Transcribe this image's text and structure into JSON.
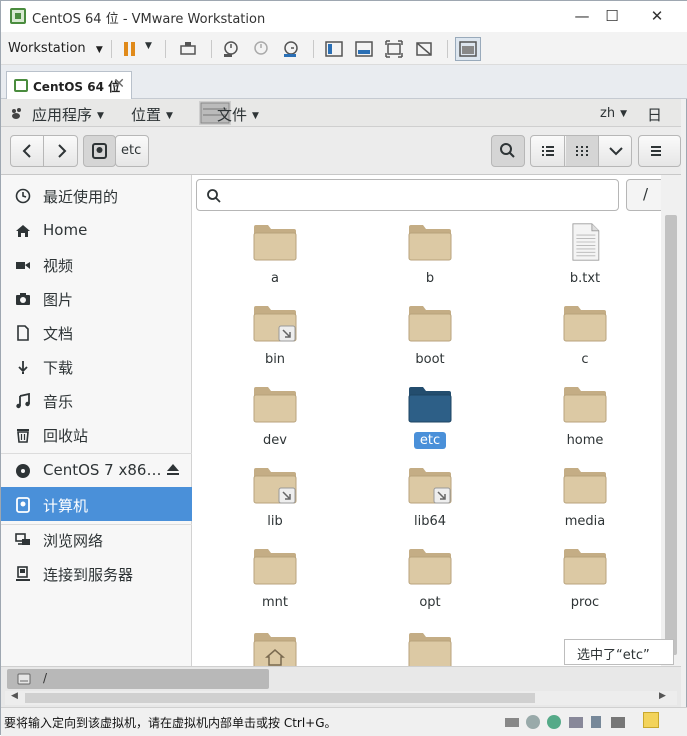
{
  "window": {
    "title": "CentOS 64 位 - VMware Workstation"
  },
  "vmtoolbar": {
    "workstation_label": "Workstation"
  },
  "tab": {
    "label": "CentOS 64 位"
  },
  "gnome": {
    "menu_apps": "应用程序",
    "menu_places": "位置",
    "menu_files": "文件",
    "lang": "zh",
    "date_partial": "日"
  },
  "header": {
    "path_label": "etc"
  },
  "sidebar": {
    "items": [
      {
        "label": "最近使用的",
        "icon": "recent-icon"
      },
      {
        "label": "Home",
        "icon": "home-icon"
      },
      {
        "label": "视频",
        "icon": "video-icon"
      },
      {
        "label": "图片",
        "icon": "camera-icon"
      },
      {
        "label": "文档",
        "icon": "document-icon"
      },
      {
        "label": "下载",
        "icon": "download-icon"
      },
      {
        "label": "音乐",
        "icon": "music-icon"
      },
      {
        "label": "回收站",
        "icon": "trash-icon"
      }
    ],
    "devices": [
      {
        "label": "CentOS 7 x86…",
        "icon": "disc-icon"
      },
      {
        "label": "计算机",
        "icon": "computer-icon"
      }
    ],
    "network": [
      {
        "label": "浏览网络",
        "icon": "network-icon"
      },
      {
        "label": "连接到服务器",
        "icon": "server-icon"
      }
    ]
  },
  "content": {
    "path_root": "/",
    "files": [
      {
        "name": "a",
        "type": "folder"
      },
      {
        "name": "b",
        "type": "folder"
      },
      {
        "name": "b.txt",
        "type": "text"
      },
      {
        "name": "bin",
        "type": "link-folder"
      },
      {
        "name": "boot",
        "type": "folder"
      },
      {
        "name": "c",
        "type": "folder"
      },
      {
        "name": "dev",
        "type": "folder"
      },
      {
        "name": "etc",
        "type": "folder-selected"
      },
      {
        "name": "home",
        "type": "folder"
      },
      {
        "name": "lib",
        "type": "link-folder"
      },
      {
        "name": "lib64",
        "type": "link-folder"
      },
      {
        "name": "media",
        "type": "folder"
      },
      {
        "name": "mnt",
        "type": "folder"
      },
      {
        "name": "opt",
        "type": "folder"
      },
      {
        "name": "proc",
        "type": "folder"
      }
    ],
    "tooltip": "选中了“etc”"
  },
  "statusbar": {
    "path": "/"
  },
  "vmstatus": {
    "message": "要将输入定向到该虚拟机，请在虚拟机内部单击或按 Ctrl+G。"
  },
  "colors": {
    "selection": "#4a90d9",
    "folder": "#dcc9a4",
    "folder_selected": "#2d5f87"
  }
}
